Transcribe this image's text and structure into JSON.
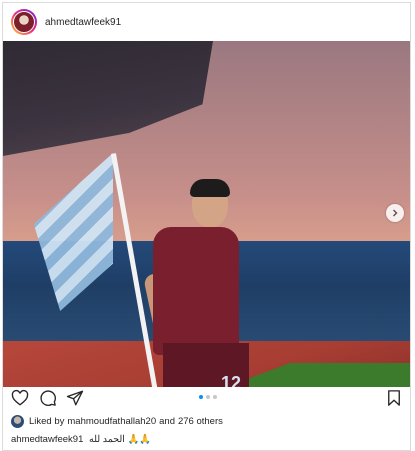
{
  "post": {
    "username": "ahmedtawfeek91",
    "image": {
      "shirt_number": "12"
    },
    "carousel": {
      "count": 3,
      "active_index": 0
    },
    "likes": {
      "prefix": "Liked by ",
      "user": "mahmoudfathallah20",
      "middle": " and ",
      "others": "276 others"
    },
    "caption": {
      "user": "ahmedtawfeek91",
      "text": "الحمد لله 🙏🙏"
    }
  },
  "icons": {
    "like": "heart-icon",
    "comment": "comment-icon",
    "share": "send-icon",
    "save": "bookmark-icon",
    "next": "chevron-right-icon"
  },
  "colors": {
    "border": "#dbdbdb",
    "text": "#262626",
    "active_dot": "#0095f6",
    "inactive_dot": "#c7c7c7",
    "jersey": "#7a1f2e"
  }
}
